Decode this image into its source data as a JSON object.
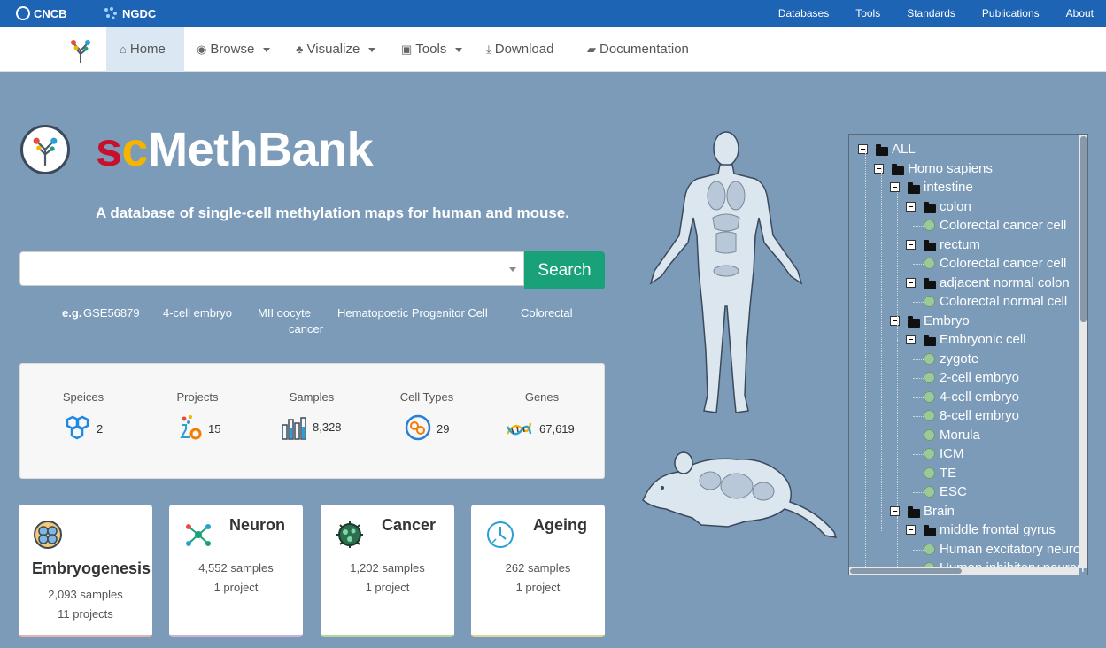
{
  "topbar": {
    "brand1": "CNCB",
    "brand2": "NGDC",
    "links": [
      "Databases",
      "Tools",
      "Standards",
      "Publications",
      "About"
    ]
  },
  "nav": {
    "home": "Home",
    "browse": "Browse",
    "visualize": "Visualize",
    "tools": "Tools",
    "download": "Download",
    "documentation": "Documentation"
  },
  "hero": {
    "title_s": "s",
    "title_c": "c",
    "title_rest": "MethBank",
    "subtitle": "A database of single-cell methylation maps for human and mouse."
  },
  "search": {
    "value": "",
    "placeholder": "",
    "button": "Search",
    "examples_label": "e.g.",
    "examples": [
      "GSE56879",
      "4-cell embryo",
      "MII oocyte",
      "Hematopoetic Progenitor Cell",
      "Colorectal",
      "cancer"
    ]
  },
  "stats": [
    {
      "label": "Speices",
      "value": "2"
    },
    {
      "label": "Projects",
      "value": "15"
    },
    {
      "label": "Samples",
      "value": "8,328"
    },
    {
      "label": "Cell Types",
      "value": "29"
    },
    {
      "label": "Genes",
      "value": "67,619"
    }
  ],
  "cards": [
    {
      "title": "Embryogenesis",
      "samples": "2,093 samples",
      "projects": "11 projects"
    },
    {
      "title": "Neuron",
      "samples": "4,552 samples",
      "projects": "1 project"
    },
    {
      "title": "Cancer",
      "samples": "1,202 samples",
      "projects": "1 project"
    },
    {
      "title": "Ageing",
      "samples": "262 samples",
      "projects": "1 project"
    }
  ],
  "tree": [
    {
      "text": "ALL",
      "type": "folder"
    },
    {
      "text": "Homo sapiens",
      "type": "folder"
    },
    {
      "text": "intestine",
      "type": "folder"
    },
    {
      "text": "colon",
      "type": "folder"
    },
    {
      "text": "Colorectal cancer cell",
      "type": "leaf"
    },
    {
      "text": "rectum",
      "type": "folder"
    },
    {
      "text": "Colorectal cancer cell",
      "type": "leaf"
    },
    {
      "text": "adjacent normal colon",
      "type": "folder"
    },
    {
      "text": "Colorectal normal cell",
      "type": "leaf"
    },
    {
      "text": "Embryo",
      "type": "folder"
    },
    {
      "text": "Embryonic cell",
      "type": "folder"
    },
    {
      "text": "zygote",
      "type": "leaf"
    },
    {
      "text": "2-cell embryo",
      "type": "leaf"
    },
    {
      "text": "4-cell embryo",
      "type": "leaf"
    },
    {
      "text": "8-cell embryo",
      "type": "leaf"
    },
    {
      "text": "Morula",
      "type": "leaf"
    },
    {
      "text": "ICM",
      "type": "leaf"
    },
    {
      "text": "TE",
      "type": "leaf"
    },
    {
      "text": "ESC",
      "type": "leaf"
    },
    {
      "text": "Brain",
      "type": "folder"
    },
    {
      "text": "middle frontal gyrus",
      "type": "folder"
    },
    {
      "text": "Human excitatory neuron",
      "type": "leaf"
    },
    {
      "text": "Human inhibitory neuron",
      "type": "leaf"
    }
  ],
  "colors": {
    "topbar": "#1e64b4",
    "background": "#7b9bb9",
    "search_button": "#19a27a",
    "title_s": "#c8102e",
    "title_c": "#f5b400"
  }
}
